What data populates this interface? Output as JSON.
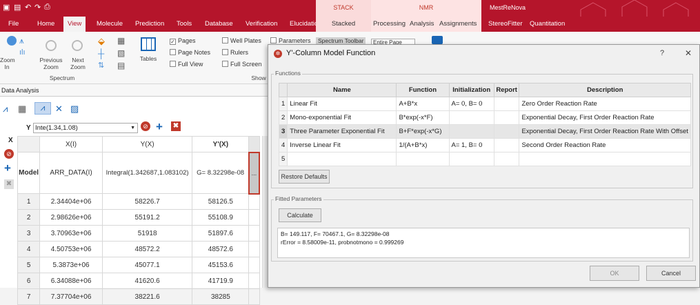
{
  "titlebar": {
    "groups": {
      "stack": "STACK",
      "nmr": "NMR",
      "mestrenova": "MestReNova"
    }
  },
  "tabs": [
    "File",
    "Home",
    "View",
    "Molecule",
    "Prediction",
    "Tools",
    "Database",
    "Verification",
    "Elucidation",
    "Stacked",
    "Processing",
    "Analysis",
    "Assignments",
    "StereoFitter",
    "Quantitation"
  ],
  "ribbon": {
    "zoom_in": "Zoom In",
    "previous_zoom": "Previous Zoom",
    "next_zoom": "Next Zoom",
    "tables": "Tables",
    "spectrum_group": "Spectrum",
    "show_group": "Show",
    "checks": [
      {
        "label": "Pages",
        "checked": true
      },
      {
        "label": "Page Notes",
        "checked": false
      },
      {
        "label": "Full View",
        "checked": false
      },
      {
        "label": "Well Plates",
        "checked": false
      },
      {
        "label": "Rulers",
        "checked": false
      },
      {
        "label": "Full Screen",
        "checked": false
      },
      {
        "label": "Parameters",
        "checked": false
      }
    ],
    "spectrum_toolbar": "Spectrum Toolbar",
    "page_select": "Entire Page"
  },
  "data_analysis": {
    "title": "Data Analysis",
    "y_label": "Y",
    "y_value": "Inte(1.34,1.08)",
    "x_label": "X",
    "headers": [
      "X(I)",
      "Y(X)",
      "Y'(X)"
    ],
    "model": {
      "label": "Model",
      "x": "ARR_DATA(I)",
      "y": "Integral(1.342687,1.083102)",
      "yp": "G= 8.32298e-08",
      "more": "..."
    },
    "rows": [
      [
        "1",
        "2.34404e+06",
        "58226.7",
        "58126.5"
      ],
      [
        "2",
        "2.98626e+06",
        "55191.2",
        "55108.9"
      ],
      [
        "3",
        "3.70963e+06",
        "51918",
        "51897.6"
      ],
      [
        "4",
        "4.50753e+06",
        "48572.2",
        "48572.6"
      ],
      [
        "5",
        "5.3873e+06",
        "45077.1",
        "45153.6"
      ],
      [
        "6",
        "6.34088e+06",
        "41620.6",
        "41719.9"
      ],
      [
        "7",
        "7.37704e+06",
        "38221.6",
        "38285"
      ]
    ]
  },
  "dialog": {
    "title": "Y'-Column Model Function",
    "help": "?",
    "close": "✕",
    "functions_label": "Functions",
    "headers": [
      "Name",
      "Function",
      "Initialization",
      "Report",
      "Description"
    ],
    "rows": [
      {
        "n": "1",
        "name": "Linear Fit",
        "function": "A+B*x",
        "init": "A= 0, B= 0",
        "report": "",
        "description": "Zero Order Reaction Rate"
      },
      {
        "n": "2",
        "name": "Mono-exponential Fit",
        "function": "B*exp(-x*F)",
        "init": "",
        "report": "",
        "description": "Exponential Decay, First Order Reaction Rate"
      },
      {
        "n": "3",
        "name": "Three Parameter Exponential Fit",
        "function": "B+F*exp(-x*G)",
        "init": "",
        "report": "",
        "description": "Exponential Decay, First Order Reaction Rate With Offset"
      },
      {
        "n": "4",
        "name": "Inverse Linear Fit",
        "function": "1/(A+B*x)",
        "init": "A= 1, B= 0",
        "report": "",
        "description": "Second Order Reaction Rate"
      },
      {
        "n": "5",
        "name": "",
        "function": "",
        "init": "",
        "report": "",
        "description": ""
      }
    ],
    "restore_defaults": "Restore Defaults",
    "fitted_label": "Fitted Parameters",
    "calculate": "Calculate",
    "result_line1": "B= 149.117, F= 70467.1, G= 8.32298e-08",
    "result_line2": "rError = 8.58009e-11, probnotmono = 0.999269",
    "ok": "OK",
    "cancel": "Cancel"
  }
}
